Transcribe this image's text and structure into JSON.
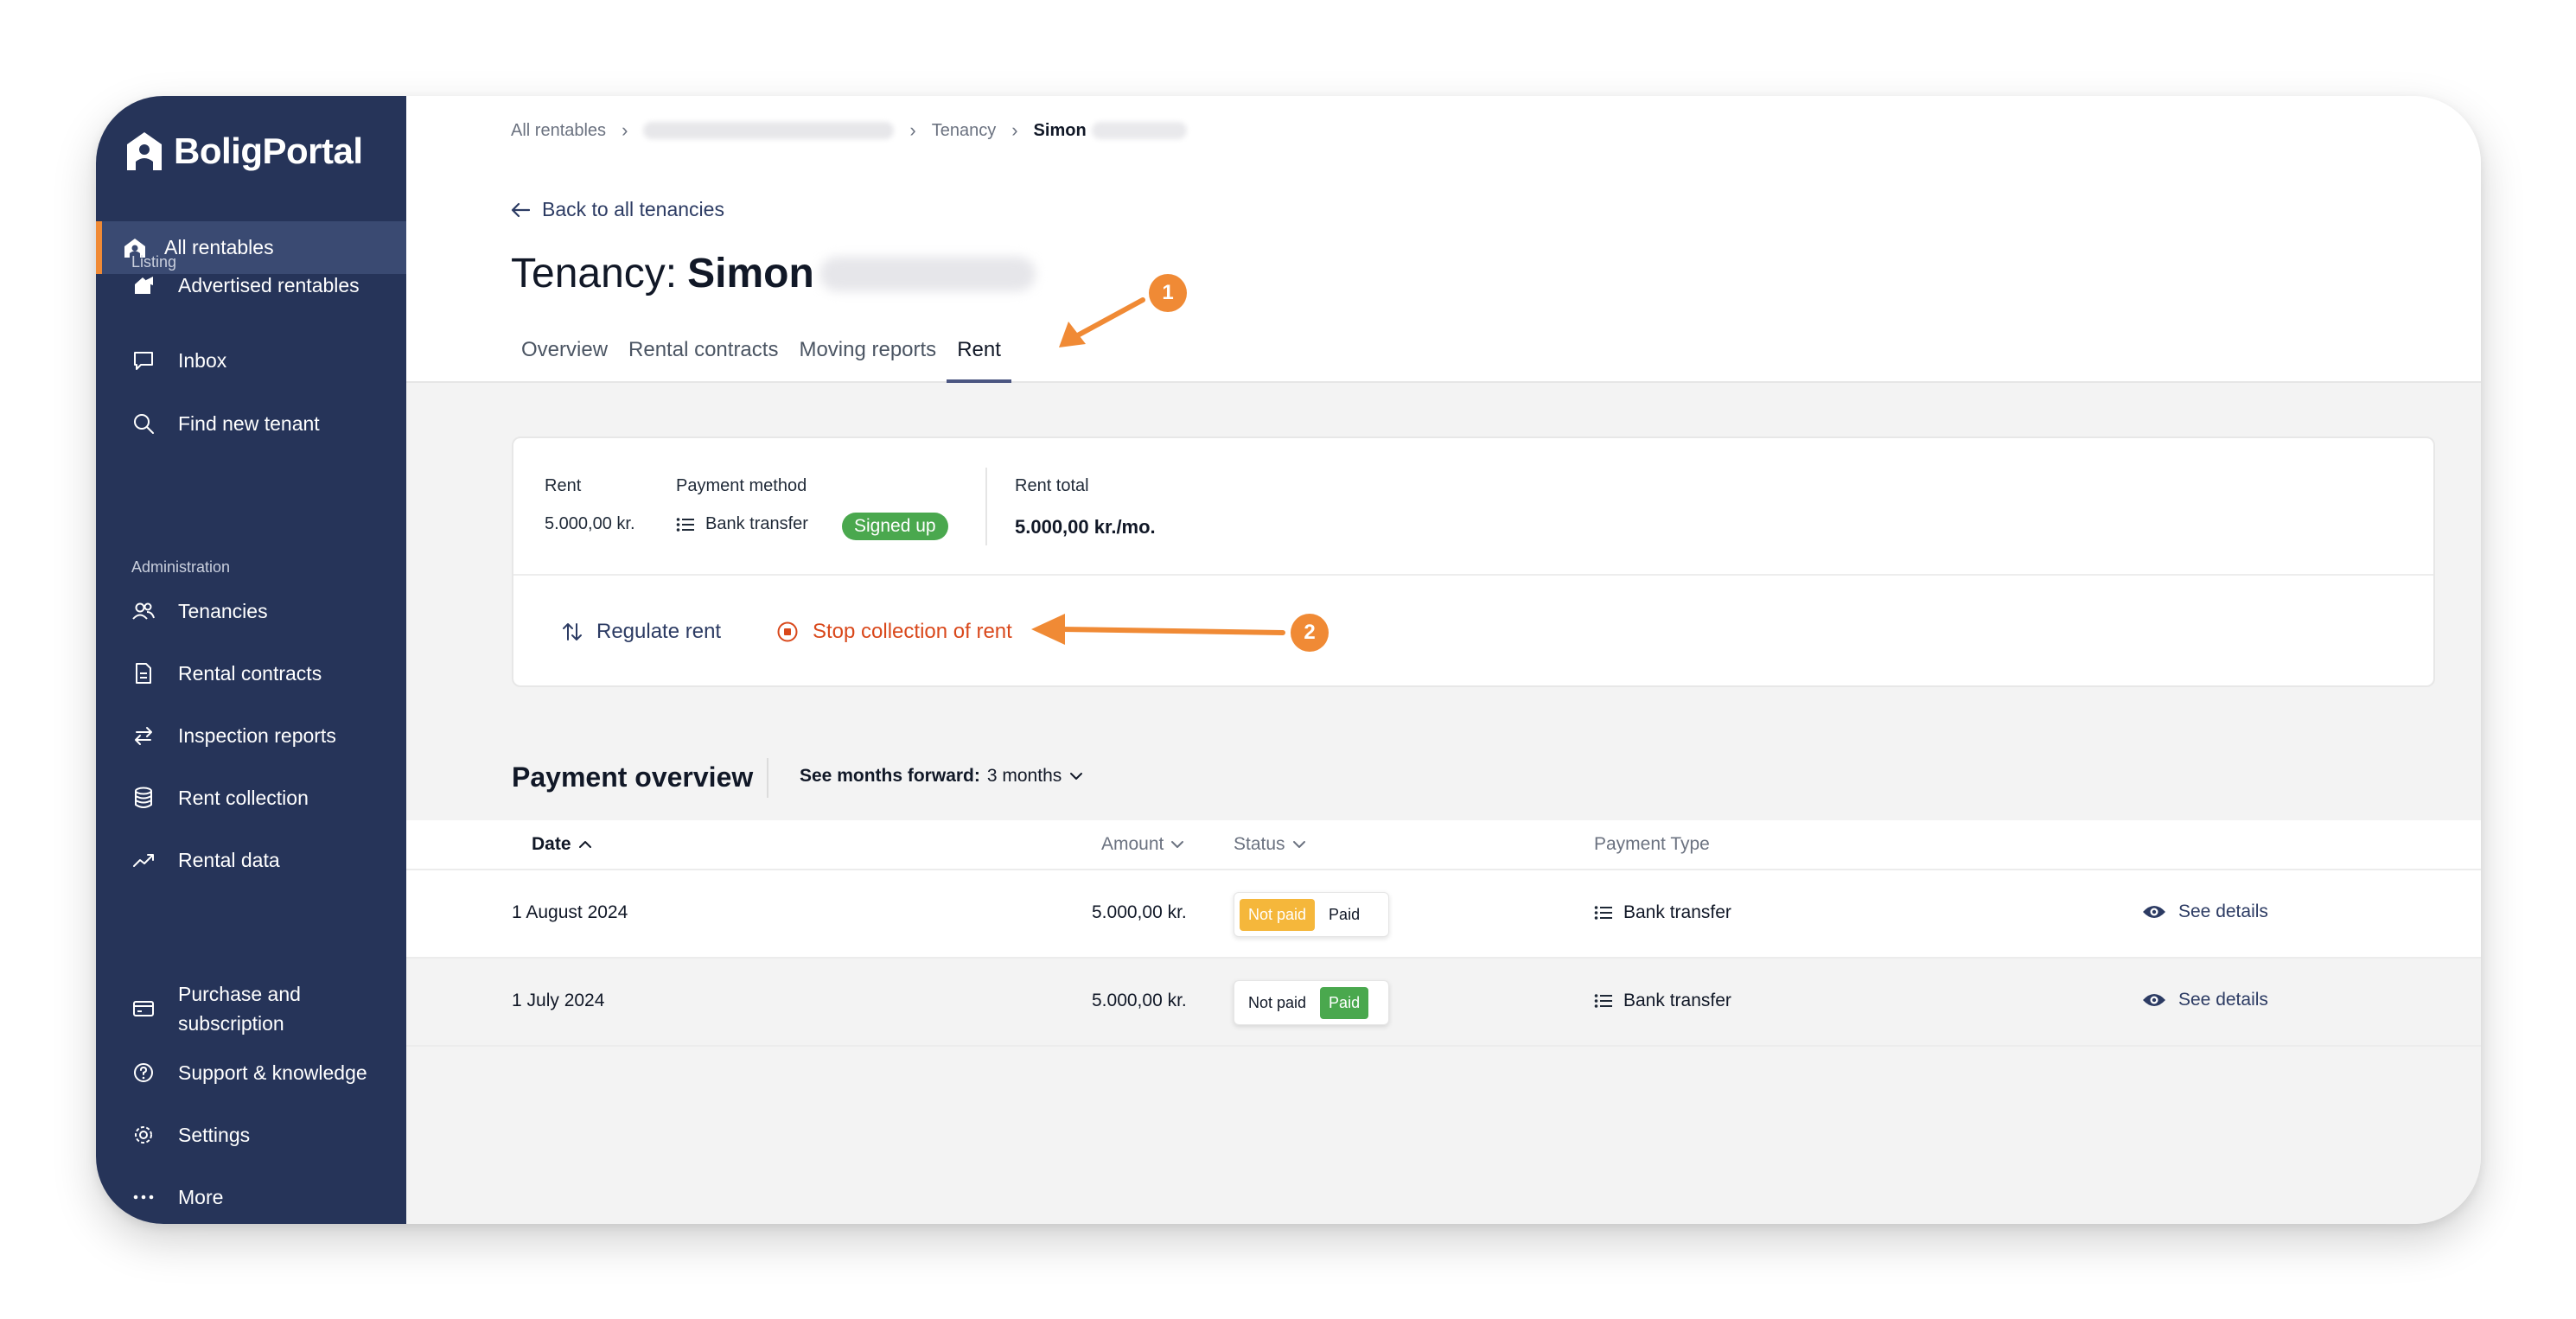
{
  "app": {
    "brand": "BoligPortal"
  },
  "colors": {
    "sidebar_bg": "#263459",
    "accent_orange": "#f08a35",
    "paid_green": "#4aa84e",
    "not_paid_yellow": "#f5b73b",
    "stop_red": "#d9481b"
  },
  "sidebar": {
    "active_item": "All rentables",
    "section_listing": "Listing",
    "section_administration": "Administration",
    "listing_items": [
      "Advertised rentables",
      "Inbox",
      "Find new tenant"
    ],
    "admin_items": [
      "Tenancies",
      "Rental contracts",
      "Inspection reports",
      "Rent collection",
      "Rental data"
    ],
    "bottom_items": [
      "Purchase and subscription",
      "Support & knowledge",
      "Settings",
      "More"
    ]
  },
  "breadcrumb": {
    "root": "All rentables",
    "tenancy": "Tenancy",
    "current": "Simon"
  },
  "back_link": "Back to all tenancies",
  "page": {
    "title_prefix": "Tenancy:",
    "title_name": "Simon"
  },
  "tabs": [
    "Overview",
    "Rental contracts",
    "Moving reports",
    "Rent"
  ],
  "active_tab": "Rent",
  "rent_card": {
    "rent_label": "Rent",
    "rent_value": "5.000,00 kr.",
    "payment_method_label": "Payment method",
    "payment_method_value": "Bank transfer",
    "signed_badge": "Signed up",
    "rent_total_label": "Rent total",
    "rent_total_value": "5.000,00 kr./mo.",
    "regulate_label": "Regulate rent",
    "stop_label": "Stop collection of rent"
  },
  "payment_overview": {
    "title": "Payment overview",
    "filter_label": "See months forward:",
    "filter_value": "3 months",
    "columns": {
      "date": "Date",
      "amount": "Amount",
      "status": "Status",
      "payment_type": "Payment Type"
    },
    "rows": [
      {
        "date": "1 August 2024",
        "amount": "5.000,00 kr.",
        "status_not_paid": "Not paid",
        "status_paid": "Paid",
        "selected": "Not paid",
        "payment_type": "Bank transfer",
        "details": "See details"
      },
      {
        "date": "1 July 2024",
        "amount": "5.000,00 kr.",
        "status_not_paid": "Not paid",
        "status_paid": "Paid",
        "selected": "Paid",
        "payment_type": "Bank transfer",
        "details": "See details"
      }
    ]
  },
  "annotations": {
    "marker1": "1",
    "marker2": "2"
  }
}
